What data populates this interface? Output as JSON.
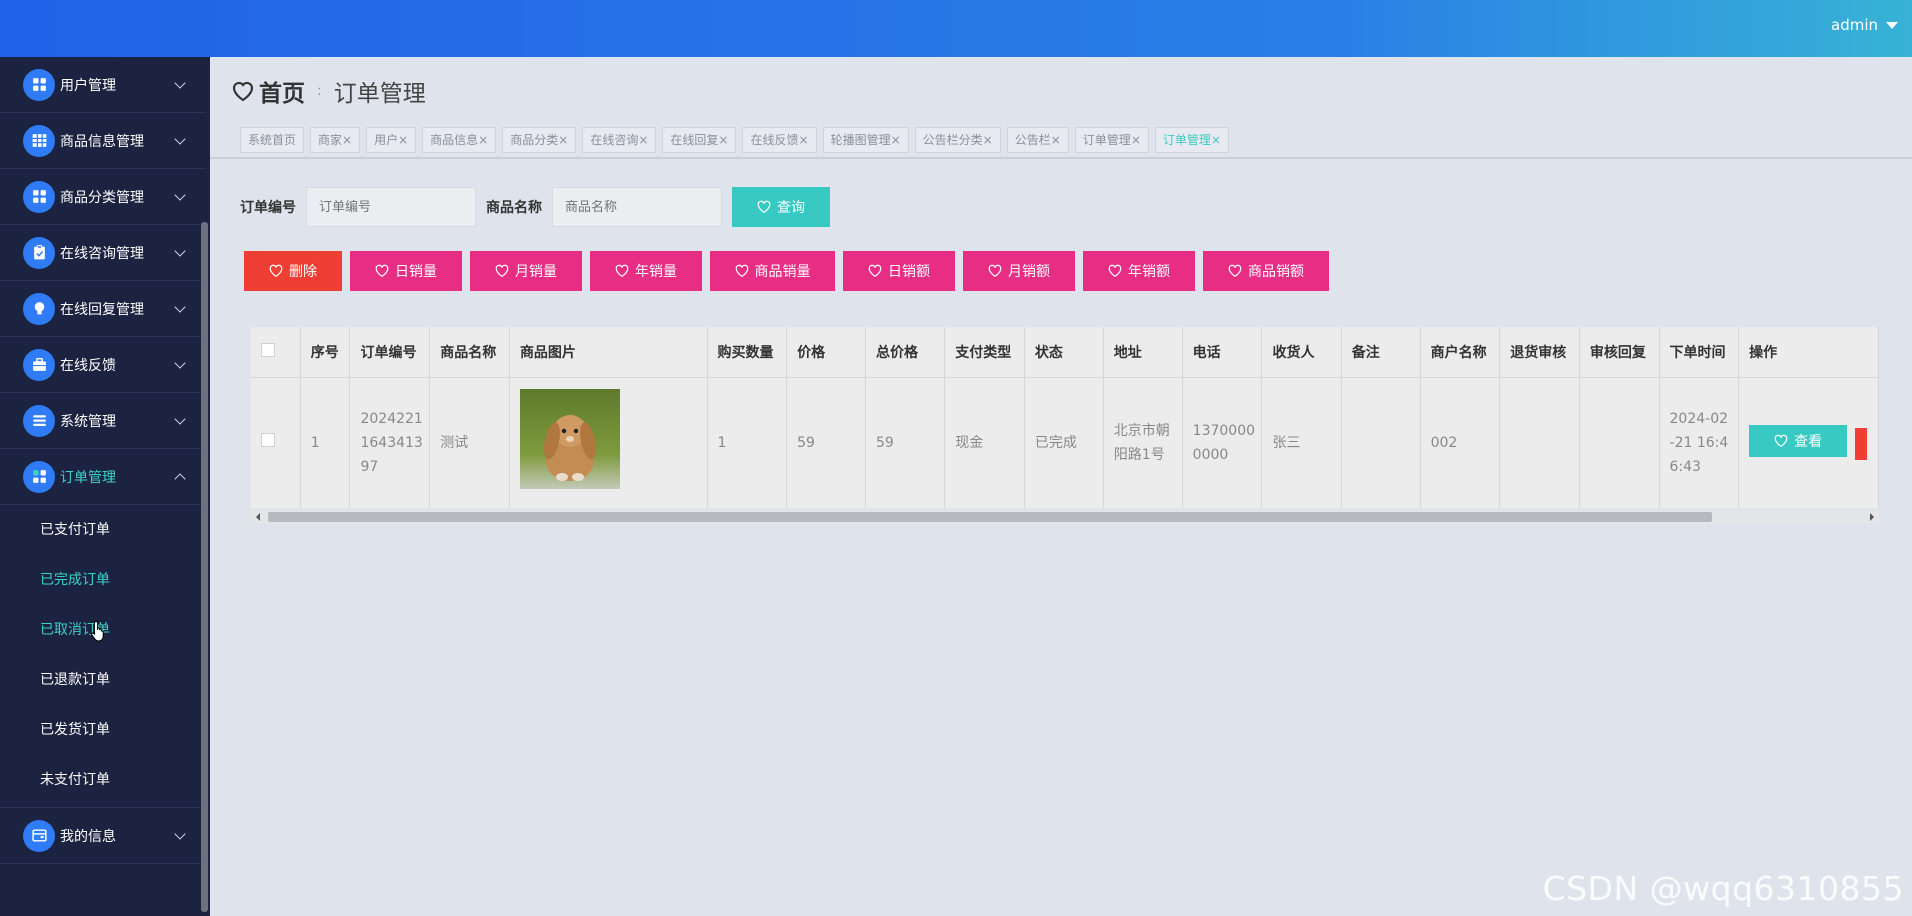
{
  "header": {
    "user_name": "admin"
  },
  "sidebar": {
    "items": [
      {
        "label": "用户管理",
        "icon": "grid-icon"
      },
      {
        "label": "商品信息管理",
        "icon": "table-icon"
      },
      {
        "label": "商品分类管理",
        "icon": "grid-icon"
      },
      {
        "label": "在线咨询管理",
        "icon": "clipboard-icon"
      },
      {
        "label": "在线回复管理",
        "icon": "lightbulb-icon"
      },
      {
        "label": "在线反馈",
        "icon": "briefcase-icon"
      },
      {
        "label": "系统管理",
        "icon": "list-icon"
      },
      {
        "label": "订单管理",
        "icon": "grid-icon"
      }
    ],
    "order_sub": [
      "已支付订单",
      "已完成订单",
      "已取消订单",
      "已退款订单",
      "已发货订单",
      "未支付订单"
    ],
    "last_item": {
      "label": "我的信息",
      "icon": "wallet-icon"
    }
  },
  "breadcrumb": {
    "home": "首页",
    "current": "订单管理"
  },
  "tabs": [
    "系统首页",
    "商家",
    "用户",
    "商品信息",
    "商品分类",
    "在线咨询",
    "在线回复",
    "在线反馈",
    "轮播图管理",
    "公告栏分类",
    "公告栏",
    "订单管理",
    "订单管理"
  ],
  "search": {
    "order_no_label": "订单编号",
    "order_no_placeholder": "订单编号",
    "goods_label": "商品名称",
    "goods_placeholder": "商品名称",
    "query_label": "查询"
  },
  "actions": [
    "删除",
    "日销量",
    "月销量",
    "年销量",
    "商品销量",
    "日销额",
    "月销额",
    "年销额",
    "商品销额"
  ],
  "table": {
    "columns": [
      "序号",
      "订单编号",
      "商品名称",
      "商品图片",
      "购买数量",
      "价格",
      "总价格",
      "支付类型",
      "状态",
      "地址",
      "电话",
      "收货人",
      "备注",
      "商户名称",
      "退货审核",
      "审核回复",
      "下单时间",
      "操作"
    ],
    "row": {
      "index": "1",
      "order_no": "202422116434 1397",
      "order_no_lines": [
        "2024221",
        "1643413",
        "97"
      ],
      "goods": "测试",
      "qty": "1",
      "price": "59",
      "total": "59",
      "pay_type": "现金",
      "status": "已完成",
      "address_lines": [
        "北京市朝",
        "阳路1号"
      ],
      "phone_lines": [
        "1370000",
        "0000"
      ],
      "receiver": "张三",
      "remark": "",
      "merchant": "002",
      "return_audit": "",
      "audit_reply": "",
      "time_lines": [
        "2024-02",
        "-21 16:4",
        "6:43"
      ],
      "view_label": "查看"
    }
  },
  "watermark": "CSDN @wqq6310855",
  "colors": {
    "accent": "#37c9c2",
    "danger": "#ef3f34",
    "pink": "#e72d84",
    "sidebar": "#1c2340"
  }
}
